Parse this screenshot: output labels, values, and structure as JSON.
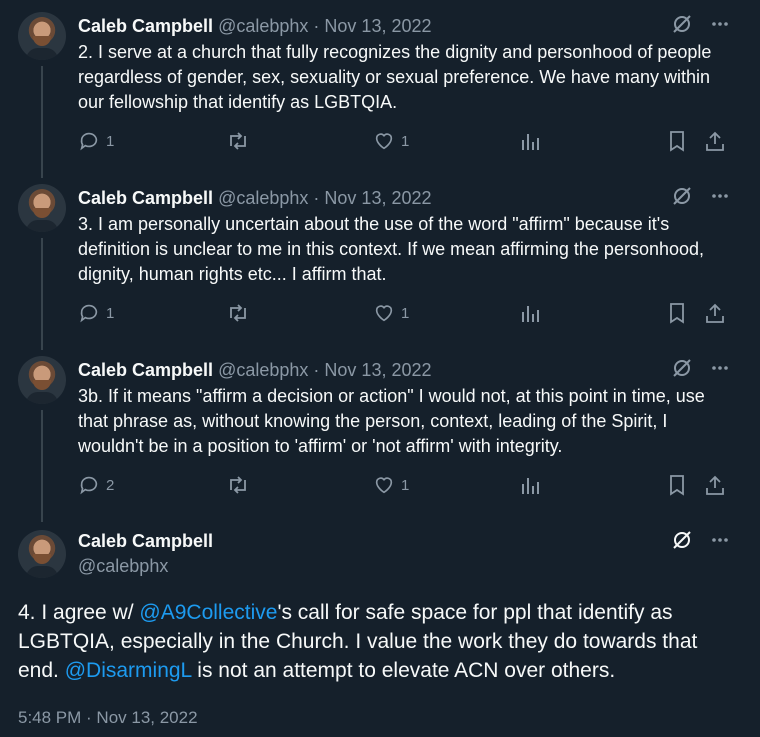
{
  "tweets": [
    {
      "name": "Caleb Campbell",
      "handle": "@calebphx",
      "separator": "·",
      "date": "Nov 13, 2022",
      "text": "2. I serve at a church that fully recognizes the dignity and personhood of people regardless of gender, sex, sexuality or sexual preference. We have many within our fellowship that identify as LGBTQIA.",
      "reply_count": "1",
      "like_count": "1"
    },
    {
      "name": "Caleb Campbell",
      "handle": "@calebphx",
      "separator": "·",
      "date": "Nov 13, 2022",
      "text": "3. I am personally uncertain about the use of the word \"affirm\" because it's definition is unclear to me in this context. If we mean affirming the personhood, dignity, human rights etc... I affirm that.",
      "reply_count": "1",
      "like_count": "1"
    },
    {
      "name": "Caleb Campbell",
      "handle": "@calebphx",
      "separator": "·",
      "date": "Nov 13, 2022",
      "text": "3b. If it means \"affirm a decision or action\" I would not, at this point in time, use that phrase as, without knowing the person, context, leading of the Spirit, I wouldn't be in a position to 'affirm' or 'not affirm' with integrity.",
      "reply_count": "2",
      "like_count": "1"
    }
  ],
  "main_tweet": {
    "name": "Caleb Campbell",
    "handle": "@calebphx",
    "text_part1": "4. I agree w/ ",
    "mention1": "@A9Collective",
    "text_part2": "'s call for safe space for ppl that identify as LGBTQIA, especially in the Church. I value the work they do towards that end. ",
    "mention2": "@DisarmingL",
    "text_part3": " is not an attempt to elevate ACN over others.",
    "timestamp": "5:48 PM · Nov 13, 2022"
  },
  "icons": {
    "grok": "grok-icon",
    "more": "more-icon",
    "reply": "reply-icon",
    "retweet": "retweet-icon",
    "like": "heart-icon",
    "views": "analytics-icon",
    "bookmark": "bookmark-icon",
    "share": "share-icon"
  },
  "colors": {
    "background": "#15202b",
    "text": "#f7f9f9",
    "muted": "#8b98a5",
    "link": "#1d9bf0",
    "thread_line": "#38444d"
  }
}
